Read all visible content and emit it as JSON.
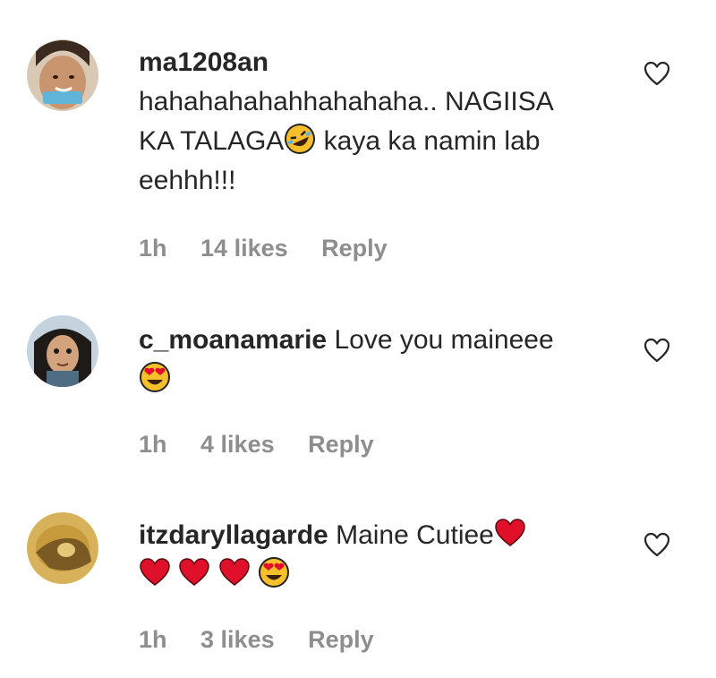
{
  "comments": [
    {
      "username": "ma1208an",
      "text_line1": "hahahahahahhahahaha.. NAGIISA",
      "text_line2a": "KA TALAGA",
      "text_line2b": " kaya ka namin lab",
      "text_line3": "eehhh!!!",
      "time": "1h",
      "likes": "14 likes",
      "reply": "Reply",
      "emoji": [
        "rolling-on-floor-laughing"
      ]
    },
    {
      "username": "c_moanamarie",
      "text": " Love you maineee",
      "time": "1h",
      "likes": "4 likes",
      "reply": "Reply",
      "emoji": [
        "heart-eyes"
      ]
    },
    {
      "username": "itzdaryllagarde",
      "text": " Maine Cutiee",
      "time": "1h",
      "likes": "3 likes",
      "reply": "Reply",
      "emoji": [
        "red-heart",
        "red-heart",
        "red-heart",
        "red-heart",
        "heart-eyes"
      ]
    }
  ],
  "icons": {
    "like": "heart-outline-icon"
  },
  "colors": {
    "text": "#262626",
    "meta": "#8e8e8e",
    "heart_red": "#e0102a",
    "emoji_yellow": "#f7c02b"
  }
}
